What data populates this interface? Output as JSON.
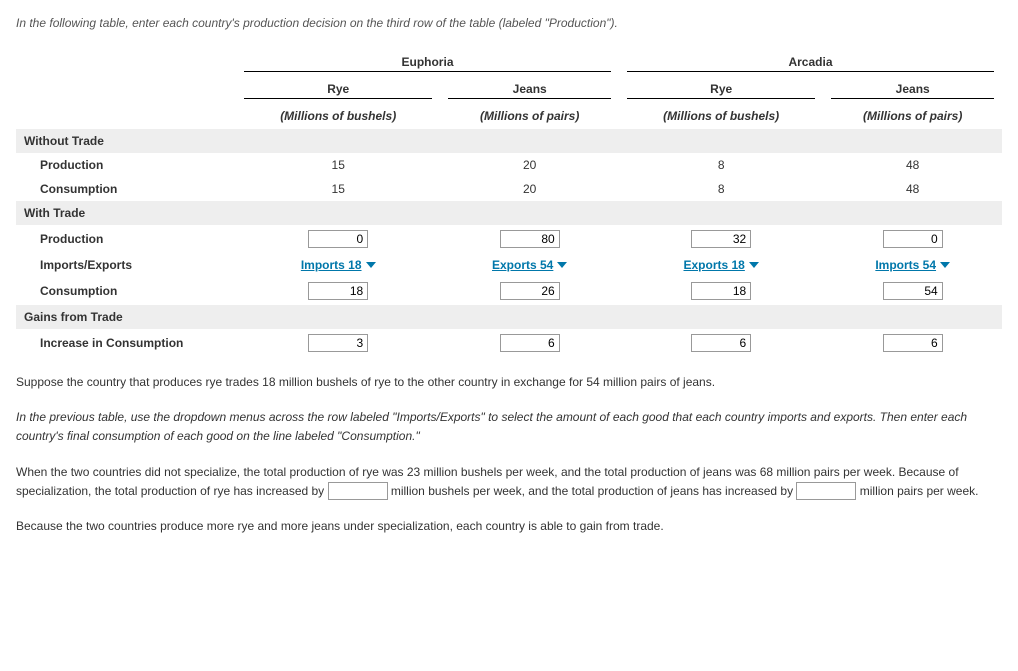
{
  "instruction_top": "In the following table, enter each country's production decision on the third row of the table (labeled \"Production\").",
  "countries": {
    "c1": "Euphoria",
    "c2": "Arcadia"
  },
  "goods": {
    "g1": "Rye",
    "g2": "Jeans"
  },
  "units": {
    "u1": "(Millions of bushels)",
    "u2": "(Millions of pairs)",
    "u3": "(Millions of bushels)",
    "u4": "(Millions of pairs)"
  },
  "sections": {
    "without_trade": "Without Trade",
    "with_trade": "With Trade",
    "gains": "Gains from Trade"
  },
  "rows": {
    "production": "Production",
    "consumption": "Consumption",
    "imp_exp": "Imports/Exports",
    "increase": "Increase in Consumption"
  },
  "without_trade": {
    "production": {
      "c1g1": "15",
      "c1g2": "20",
      "c2g1": "8",
      "c2g2": "48"
    },
    "consumption": {
      "c1g1": "15",
      "c1g2": "20",
      "c2g1": "8",
      "c2g2": "48"
    }
  },
  "with_trade": {
    "production": {
      "c1g1": "0",
      "c1g2": "80",
      "c2g1": "32",
      "c2g2": "0"
    },
    "imp_exp": {
      "c1g1": "Imports  18",
      "c1g2": "Exports  54",
      "c2g1": "Exports  18",
      "c2g2": "Imports  54"
    },
    "consumption": {
      "c1g1": "18",
      "c1g2": "26",
      "c2g1": "18",
      "c2g2": "54"
    }
  },
  "gains": {
    "increase": {
      "c1g1": "3",
      "c1g2": "6",
      "c2g1": "6",
      "c2g2": "6"
    }
  },
  "paragraphs": {
    "p1": "Suppose the country that produces rye trades 18 million bushels of rye to the other country in exchange for 54 million pairs of jeans.",
    "p2": "In the previous table, use the dropdown menus across the row labeled \"Imports/Exports\" to select the amount of each good that each country imports and exports. Then enter each country's final consumption of each good on the line labeled \"Consumption.\"",
    "p3a": "When the two countries did not specialize, the total production of rye was 23 million bushels per week, and the total production of jeans was 68 million pairs per week. Because of specialization, the total production of rye has increased by ",
    "p3b": " million bushels per week, and the total production of jeans has increased by ",
    "p3c": " million pairs per week.",
    "p4": "Because the two countries produce more rye and more jeans under specialization, each country is able to gain from trade."
  },
  "blanks": {
    "rye_increase": "",
    "jeans_increase": ""
  }
}
